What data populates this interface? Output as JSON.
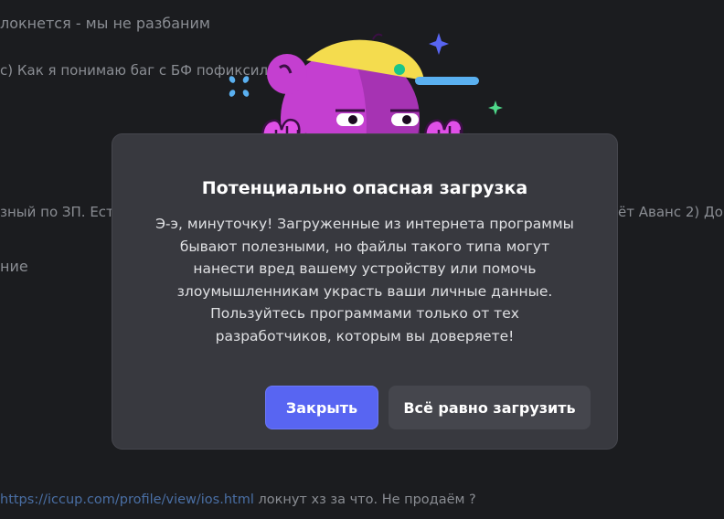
{
  "background": {
    "lines": [
      "локнется - мы не разбаним",
      "с) Как я понимаю баг с БФ пофиксили",
      "зный по ЗП. Ест",
      "ёт Аванс 2) Дон",
      "ние",
      "локнут хз за что. Не продаём ?"
    ],
    "link": "https://iccup.com/profile/view/ios.html"
  },
  "dialog": {
    "title": "Потенциально опасная загрузка",
    "body_lines": [
      "Э-э, минуточку! Загруженные из интернета программы",
      "бывают полезными, но файлы такого типа могут",
      "нанести вред вашему устройству или помочь",
      "злоумышленникам украсть ваши личные данные.",
      "Пользуйтесь программами только от тех",
      "разработчиков, которым вы доверяете!"
    ],
    "close_label": "Закрыть",
    "download_label": "Всё равно загрузить"
  },
  "colors": {
    "accent": "#5865f2",
    "modal_bg": "#38393f",
    "mascot_purple": "#c43fd0",
    "mascot_cap": "#f4dc4e"
  },
  "icons": [
    "sparkle-icon",
    "mascot-illustration"
  ]
}
